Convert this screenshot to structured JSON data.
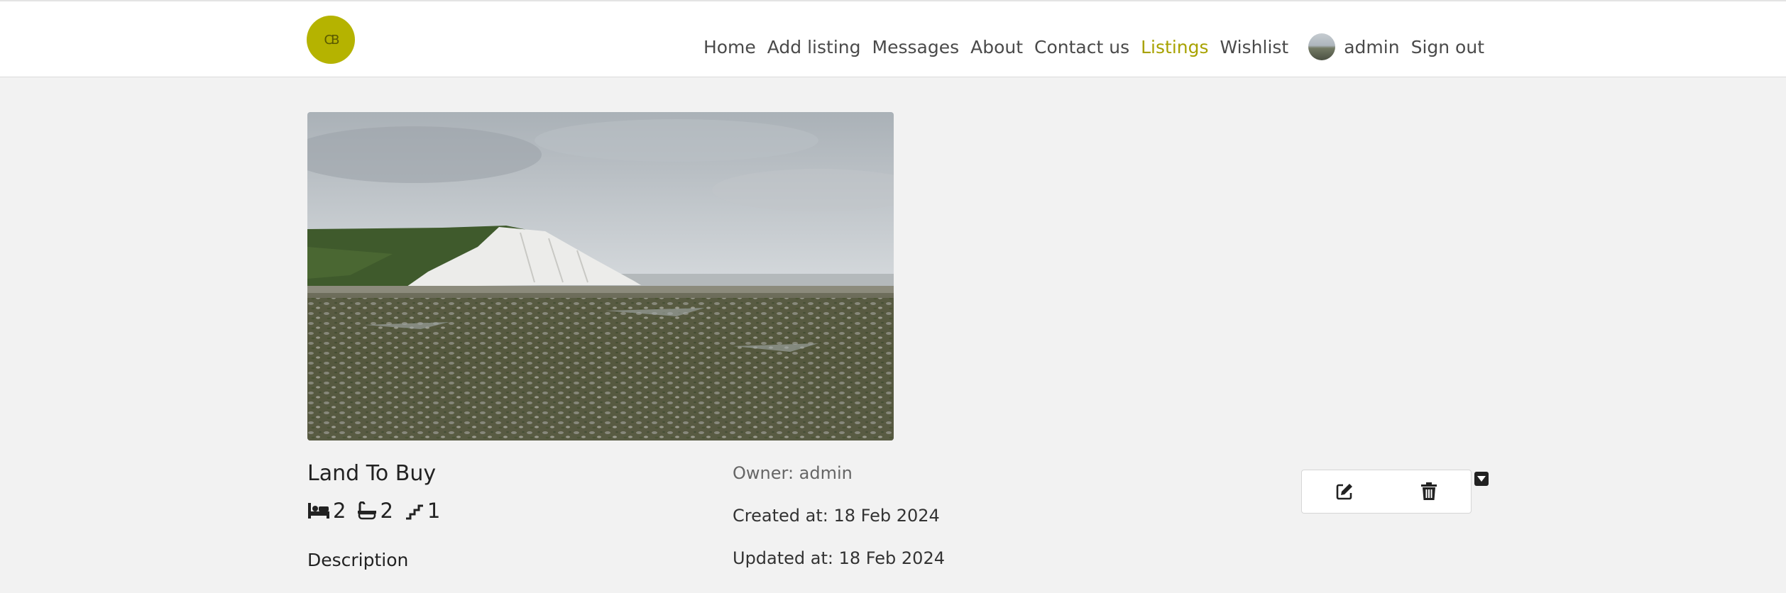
{
  "logo": {
    "monogram": "CB"
  },
  "nav": {
    "links": [
      "Home",
      "Add listing",
      "Messages",
      "About",
      "Contact us",
      "Listings",
      "Wishlist"
    ],
    "active_index": 5,
    "username": "admin",
    "sign_out": "Sign out"
  },
  "listing": {
    "title": "Land To Buy",
    "bedrooms": "2",
    "bathrooms": "2",
    "floors": "1",
    "description_heading": "Description",
    "owner": "Owner: admin",
    "created_at": "Created at: 18 Feb 2024",
    "updated_at": "Updated at: 18 Feb 2024"
  },
  "icons": {
    "edit": "edit-icon",
    "delete": "trash-icon",
    "dropdown": "caret-down-icon",
    "bed": "bed-icon",
    "bath": "bath-icon",
    "stairs": "stairs-icon"
  },
  "colors": {
    "accent": "#a8a200",
    "logo_bg": "#b5b300",
    "page_bg": "#f2f2f2"
  }
}
